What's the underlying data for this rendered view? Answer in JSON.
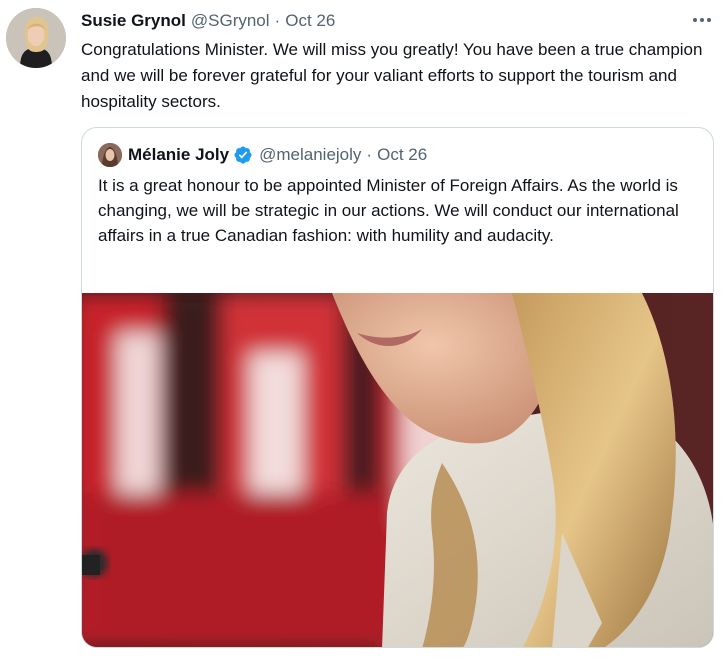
{
  "tweet": {
    "author_name": "Susie Grynol",
    "author_handle": "@SGrynol",
    "separator": "·",
    "date": "Oct 26",
    "text": "Congratulations Minister. We will miss you greatly! You have been a true champion and we will be forever grateful for your valiant efforts to support the tourism and hospitality sectors.",
    "more_icon": "more-horizontal-icon"
  },
  "quoted_tweet": {
    "author_name": "Mélanie Joly",
    "verified_icon": "verified-badge-icon",
    "author_handle": "@melaniejoly",
    "separator": "·",
    "date": "Oct 26",
    "text": "It is a great honour to be appointed Minister of Foreign Affairs. As the world is changing, we will be strategic in our actions. We will conduct our international affairs in a true Canadian fashion: with humility and audacity."
  },
  "colors": {
    "primary_text": "#0f1419",
    "secondary_text": "#536471",
    "border": "#cfd9de",
    "verified_blue": "#1d9bf0",
    "flag_red": "#c8232c"
  }
}
